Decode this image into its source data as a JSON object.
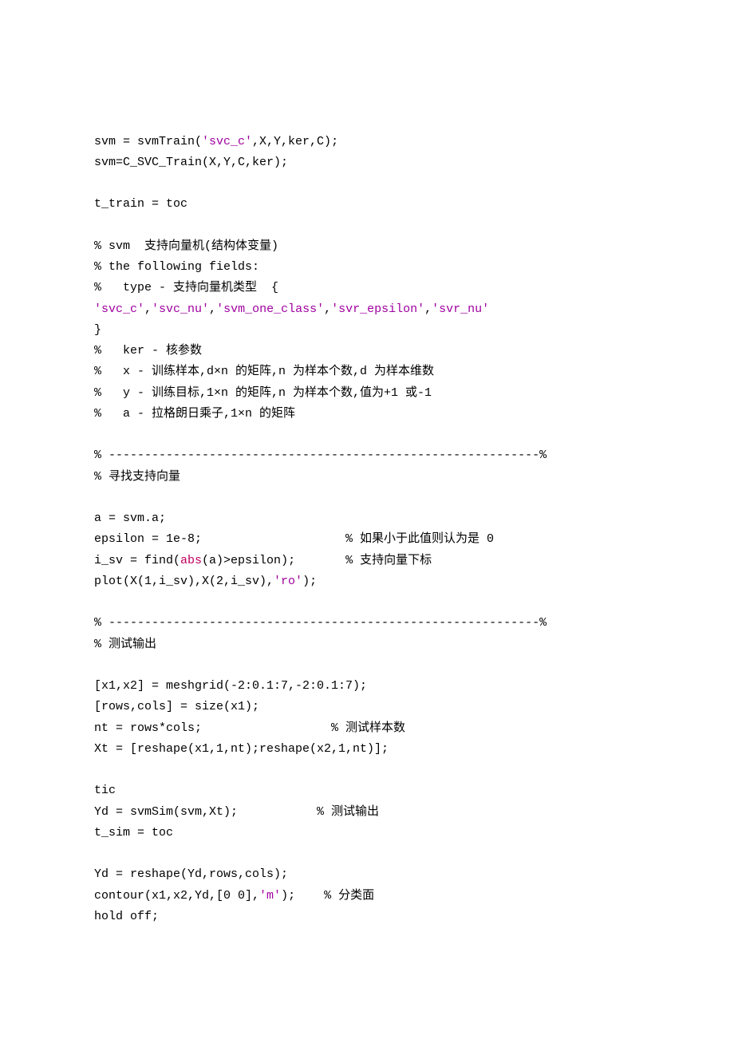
{
  "code": {
    "lines": [
      {
        "segments": [
          {
            "t": "svm = svmTrain("
          },
          {
            "t": "'svc_c'",
            "cls": "str"
          },
          {
            "t": ",X,Y,ker,C);"
          }
        ]
      },
      {
        "segments": [
          {
            "t": "svm=C_SVC_Train(X,Y,C,ker);"
          }
        ]
      },
      {
        "segments": [
          {
            "t": ""
          }
        ]
      },
      {
        "segments": [
          {
            "t": "t_train = toc"
          }
        ]
      },
      {
        "segments": [
          {
            "t": ""
          }
        ]
      },
      {
        "segments": [
          {
            "t": "% svm  支持向量机(结构体变量)"
          }
        ]
      },
      {
        "segments": [
          {
            "t": "% the following fields:"
          }
        ]
      },
      {
        "segments": [
          {
            "t": "%   type - 支持向量机类型  {"
          }
        ]
      },
      {
        "segments": [
          {
            "t": "'svc_c'",
            "cls": "str"
          },
          {
            "t": ","
          },
          {
            "t": "'svc_nu'",
            "cls": "str"
          },
          {
            "t": ","
          },
          {
            "t": "'svm_one_class'",
            "cls": "str"
          },
          {
            "t": ","
          },
          {
            "t": "'svr_epsilon'",
            "cls": "str"
          },
          {
            "t": ","
          },
          {
            "t": "'svr_nu'",
            "cls": "str"
          }
        ]
      },
      {
        "segments": [
          {
            "t": "}"
          }
        ]
      },
      {
        "segments": [
          {
            "t": "%   ker - 核参数"
          }
        ]
      },
      {
        "segments": [
          {
            "t": "%   x - 训练样本,d×n 的矩阵,n 为样本个数,d 为样本维数"
          }
        ]
      },
      {
        "segments": [
          {
            "t": "%   y - 训练目标,1×n 的矩阵,n 为样本个数,值为+1 或-1"
          }
        ]
      },
      {
        "segments": [
          {
            "t": "%   a - 拉格朗日乘子,1×n 的矩阵"
          }
        ]
      },
      {
        "segments": [
          {
            "t": ""
          }
        ]
      },
      {
        "segments": [
          {
            "t": "% ------------------------------------------------------------%"
          }
        ]
      },
      {
        "segments": [
          {
            "t": "% 寻找支持向量"
          }
        ]
      },
      {
        "segments": [
          {
            "t": ""
          }
        ]
      },
      {
        "segments": [
          {
            "t": "a = svm.a;"
          }
        ]
      },
      {
        "segments": [
          {
            "t": "epsilon = 1e-8;                    % 如果小于此值则认为是 0"
          }
        ]
      },
      {
        "segments": [
          {
            "t": "i_sv = find("
          },
          {
            "t": "abs",
            "cls": "fn"
          },
          {
            "t": "(a)>epsilon);       % 支持向量下标"
          }
        ]
      },
      {
        "segments": [
          {
            "t": "plot(X(1,i_sv),X(2,i_sv),"
          },
          {
            "t": "'ro'",
            "cls": "str"
          },
          {
            "t": ");"
          }
        ]
      },
      {
        "segments": [
          {
            "t": ""
          }
        ]
      },
      {
        "segments": [
          {
            "t": "% ------------------------------------------------------------%"
          }
        ]
      },
      {
        "segments": [
          {
            "t": "% 测试输出"
          }
        ]
      },
      {
        "segments": [
          {
            "t": ""
          }
        ]
      },
      {
        "segments": [
          {
            "t": "[x1,x2] = meshgrid(-2:0.1:7,-2:0.1:7);"
          }
        ]
      },
      {
        "segments": [
          {
            "t": "[rows,cols] = size(x1);"
          }
        ]
      },
      {
        "segments": [
          {
            "t": "nt = rows*cols;                  % 测试样本数"
          }
        ]
      },
      {
        "segments": [
          {
            "t": "Xt = [reshape(x1,1,nt);reshape(x2,1,nt)];"
          }
        ]
      },
      {
        "segments": [
          {
            "t": ""
          }
        ]
      },
      {
        "segments": [
          {
            "t": "tic"
          }
        ]
      },
      {
        "segments": [
          {
            "t": "Yd = svmSim(svm,Xt);           % 测试输出"
          }
        ]
      },
      {
        "segments": [
          {
            "t": "t_sim = toc"
          }
        ]
      },
      {
        "segments": [
          {
            "t": ""
          }
        ]
      },
      {
        "segments": [
          {
            "t": "Yd = reshape(Yd,rows,cols);"
          }
        ]
      },
      {
        "segments": [
          {
            "t": "contour(x1,x2,Yd,[0 0],"
          },
          {
            "t": "'m'",
            "cls": "str"
          },
          {
            "t": ");    % 分类面"
          }
        ]
      },
      {
        "segments": [
          {
            "t": "hold off;"
          }
        ]
      }
    ]
  }
}
